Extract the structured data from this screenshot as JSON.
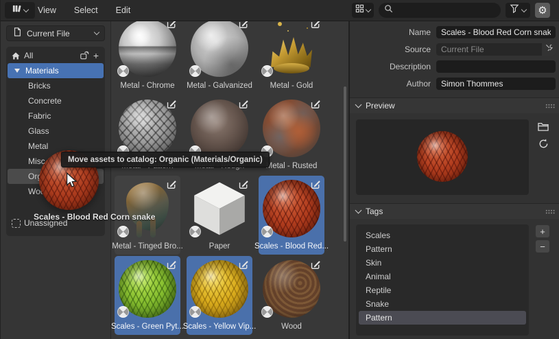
{
  "colors": {
    "selection_blue": "#4772b3",
    "tile_selected_bg": "#4a70ab",
    "drop_highlight": "#4b4b4b",
    "panel_bg": "#323232",
    "header_bg": "#2a2a2a"
  },
  "topbar": {
    "menus": [
      "View",
      "Select",
      "Edit"
    ],
    "search_value": ""
  },
  "sidebar": {
    "library": "Current File",
    "catalogs": [
      {
        "label": "All"
      },
      {
        "label": "Materials",
        "selected": true,
        "expanded": true
      },
      {
        "label": "Bricks"
      },
      {
        "label": "Concrete"
      },
      {
        "label": "Fabric"
      },
      {
        "label": "Glass"
      },
      {
        "label": "Metal"
      },
      {
        "label": "Misc"
      },
      {
        "label": "Organic",
        "drop_target": true
      },
      {
        "label": "Wood"
      },
      {
        "label": "Unassigned"
      }
    ]
  },
  "grid": {
    "items": [
      {
        "label": "Metal - Chrome",
        "state": "normal"
      },
      {
        "label": "Metal - Galvanized",
        "state": "normal"
      },
      {
        "label": "Metal - Gold",
        "state": "normal"
      },
      {
        "label": "Metal - Pattern",
        "state": "normal"
      },
      {
        "label": "Metal - Rough",
        "state": "normal"
      },
      {
        "label": "Metal - Rusted",
        "state": "normal"
      },
      {
        "label": "Metal - Tinged Bro...",
        "state": "active"
      },
      {
        "label": "Paper",
        "state": "normal"
      },
      {
        "label": "Scales - Blood Red...",
        "state": "selected"
      },
      {
        "label": "Scales - Green Pyt...",
        "state": "selected"
      },
      {
        "label": "Scales - Yellow Vip...",
        "state": "selected"
      },
      {
        "label": "Wood",
        "state": "normal"
      }
    ]
  },
  "drag": {
    "tooltip": "Move assets to catalog: Organic (Materials/Organic)",
    "label": "Scales - Blood Red Corn snake"
  },
  "details": {
    "name_label": "Name",
    "name": "Scales - Blood Red Corn snake",
    "source_label": "Source",
    "source": "Current File",
    "description_label": "Description",
    "description": "",
    "author_label": "Author",
    "author": "Simon Thommes"
  },
  "preview": {
    "title": "Preview"
  },
  "tags": {
    "title": "Tags",
    "items": [
      "Scales",
      "Pattern",
      "Skin",
      "Animal",
      "Reptile",
      "Snake",
      "Pattern"
    ],
    "selected_index": 6,
    "selected": "Pattern"
  }
}
